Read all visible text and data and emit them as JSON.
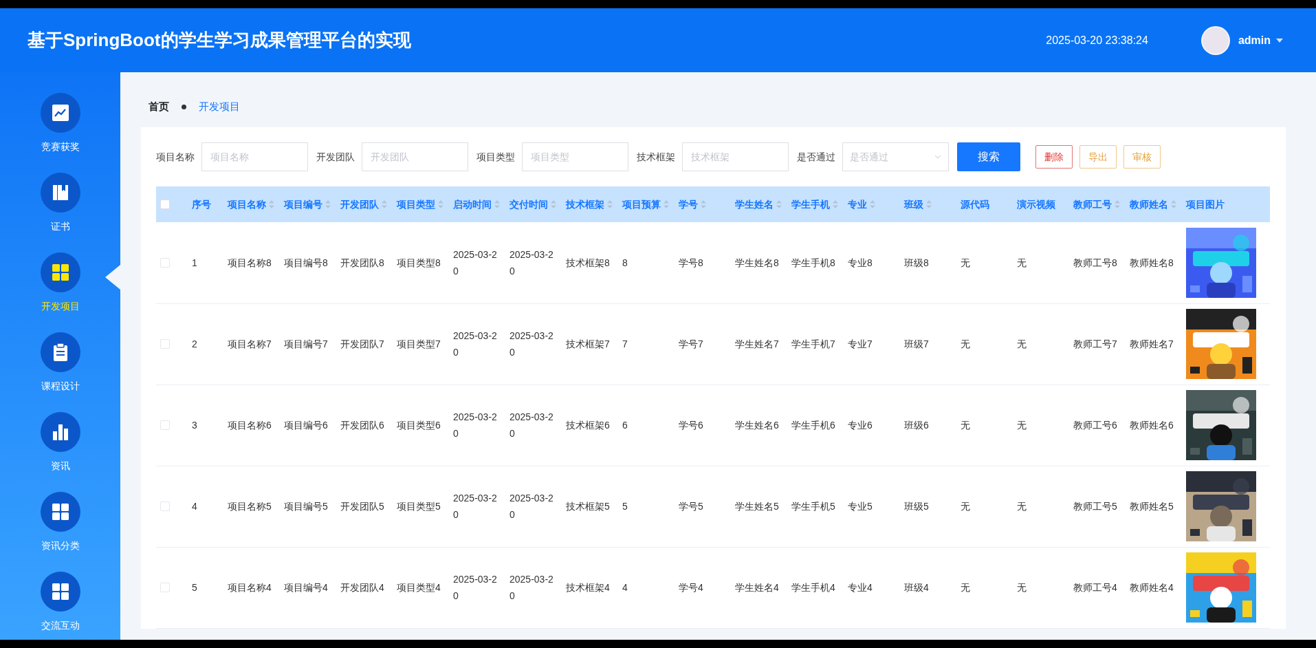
{
  "header": {
    "title": "基于SpringBoot的学生学习成果管理平台的实现",
    "datetime": "2025-03-20 23:38:24",
    "user": "admin"
  },
  "sidebar": {
    "items": [
      {
        "label": "竞赛获奖",
        "selected": false
      },
      {
        "label": "证书",
        "selected": false
      },
      {
        "label": "开发项目",
        "selected": true
      },
      {
        "label": "课程设计",
        "selected": false
      },
      {
        "label": "资讯",
        "selected": false
      },
      {
        "label": "资讯分类",
        "selected": false
      },
      {
        "label": "交流互动",
        "selected": false
      }
    ]
  },
  "breadcrumb": [
    {
      "label": "首页",
      "selected": false
    },
    {
      "label": "开发项目",
      "selected": true
    }
  ],
  "filters": [
    {
      "kind": "input",
      "label": "项目名称",
      "placeholder": "项目名称"
    },
    {
      "kind": "input",
      "label": "开发团队",
      "placeholder": "开发团队"
    },
    {
      "kind": "input",
      "label": "项目类型",
      "placeholder": "项目类型"
    },
    {
      "kind": "input",
      "label": "技术框架",
      "placeholder": "技术框架"
    },
    {
      "kind": "select",
      "label": "是否通过",
      "placeholder": "是否通过"
    }
  ],
  "buttons": [
    {
      "label": "搜索",
      "kind": "primary"
    },
    {
      "label": "删除",
      "kind": "danger"
    },
    {
      "label": "导出",
      "kind": "warning"
    },
    {
      "label": "审核",
      "kind": "warning"
    }
  ],
  "table": {
    "select_all_checked": false,
    "columns": [
      {
        "label": "序号",
        "sortable": false
      },
      {
        "label": "项目名称",
        "sortable": true
      },
      {
        "label": "项目编号",
        "sortable": true
      },
      {
        "label": "开发团队",
        "sortable": true
      },
      {
        "label": "项目类型",
        "sortable": true
      },
      {
        "label": "启动时间",
        "sortable": true
      },
      {
        "label": "交付时间",
        "sortable": true
      },
      {
        "label": "技术框架",
        "sortable": true
      },
      {
        "label": "项目预算",
        "sortable": true
      },
      {
        "label": "学号",
        "sortable": true
      },
      {
        "label": "学生姓名",
        "sortable": true
      },
      {
        "label": "学生手机",
        "sortable": true
      },
      {
        "label": "专业",
        "sortable": true
      },
      {
        "label": "班级",
        "sortable": true
      },
      {
        "label": "源代码",
        "sortable": false
      },
      {
        "label": "演示视频",
        "sortable": false
      },
      {
        "label": "教师工号",
        "sortable": true
      },
      {
        "label": "教师姓名",
        "sortable": true
      },
      {
        "label": "项目图片",
        "sortable": false
      }
    ],
    "rows": [
      {
        "checked": false,
        "cells": [
          "1",
          "项目名称8",
          "项目编号8",
          "开发团队8",
          "项目类型8",
          "2025-03-20",
          "2025-03-20",
          "技术框架8",
          "8",
          "学号8",
          "学生姓名8",
          "学生手机8",
          "专业8",
          "班级8",
          "无",
          "无",
          "教师工号8",
          "教师姓名8"
        ],
        "image": {
          "kind": "picture"
        }
      },
      {
        "checked": false,
        "cells": [
          "2",
          "项目名称7",
          "项目编号7",
          "开发团队7",
          "项目类型7",
          "2025-03-20",
          "2025-03-20",
          "技术框架7",
          "7",
          "学号7",
          "学生姓名7",
          "学生手机7",
          "专业7",
          "班级7",
          "无",
          "无",
          "教师工号7",
          "教师姓名7"
        ],
        "image": {
          "kind": "picture"
        }
      },
      {
        "checked": false,
        "cells": [
          "3",
          "项目名称6",
          "项目编号6",
          "开发团队6",
          "项目类型6",
          "2025-03-20",
          "2025-03-20",
          "技术框架6",
          "6",
          "学号6",
          "学生姓名6",
          "学生手机6",
          "专业6",
          "班级6",
          "无",
          "无",
          "教师工号6",
          "教师姓名6"
        ],
        "image": {
          "kind": "picture"
        }
      },
      {
        "checked": false,
        "cells": [
          "4",
          "项目名称5",
          "项目编号5",
          "开发团队5",
          "项目类型5",
          "2025-03-20",
          "2025-03-20",
          "技术框架5",
          "5",
          "学号5",
          "学生姓名5",
          "学生手机5",
          "专业5",
          "班级5",
          "无",
          "无",
          "教师工号5",
          "教师姓名5"
        ],
        "image": {
          "kind": "picture"
        }
      },
      {
        "checked": false,
        "cells": [
          "5",
          "项目名称4",
          "项目编号4",
          "开发团队4",
          "项目类型4",
          "2025-03-20",
          "2025-03-20",
          "技术框架4",
          "4",
          "学号4",
          "学生姓名4",
          "学生手机4",
          "专业4",
          "班级4",
          "无",
          "无",
          "教师工号4",
          "教师姓名4"
        ],
        "image": {
          "kind": "picture"
        }
      }
    ]
  }
}
